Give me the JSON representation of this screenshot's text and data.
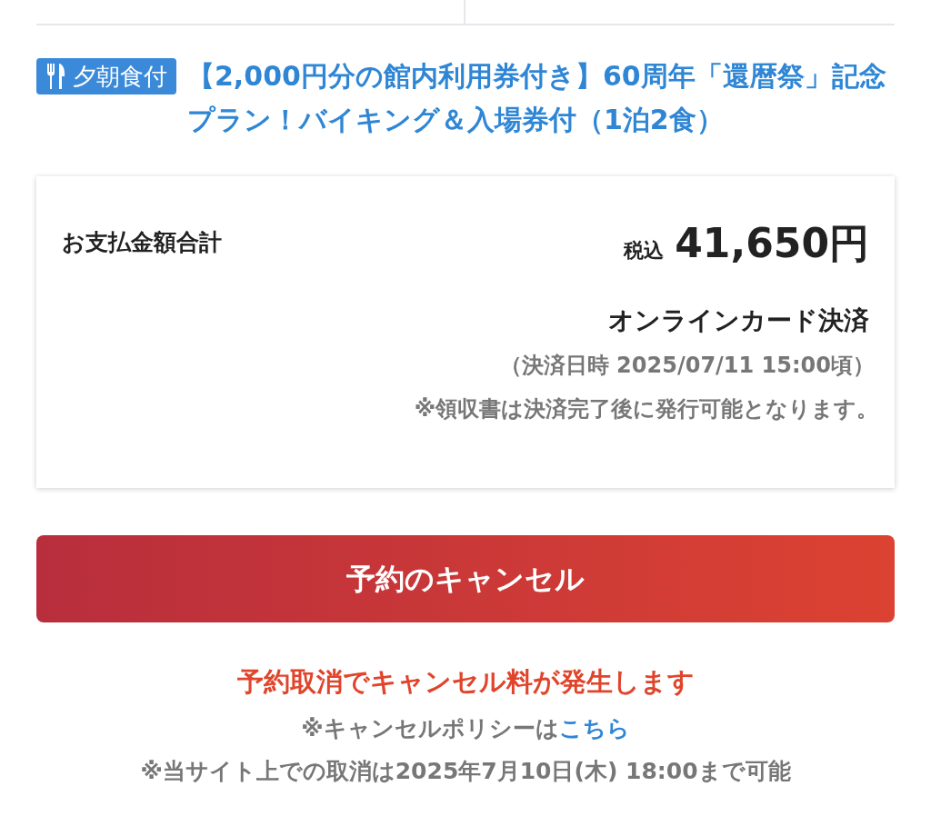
{
  "plan": {
    "badge": "夕朝食付",
    "title": "【2,000円分の館内利用券付き】60周年「還暦祭」記念プラン！バイキング＆入場券付（1泊2食）"
  },
  "payment": {
    "label": "お支払金額合計",
    "tax_note": "税込",
    "amount": "41,650円",
    "method": "オンラインカード決済",
    "date_note": "（決済日時 2025/07/11 15:00頃）",
    "receipt_note": "※領収書は決済完了後に発行可能となります。"
  },
  "cancel_button": "予約のキャンセル",
  "notices": {
    "warning": "予約取消でキャンセル料が発生します",
    "policy_text": "※キャンセルポリシーは",
    "policy_link": "こちら",
    "deadline": "※当サイト上での取消は2025年7月10日(木) 18:00まで可能"
  }
}
